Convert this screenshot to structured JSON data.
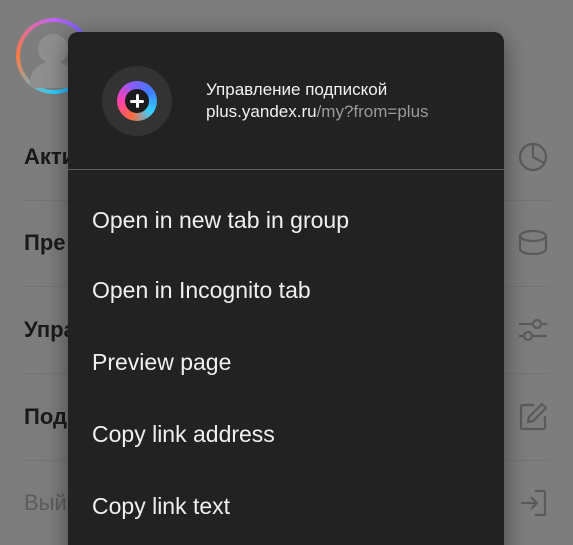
{
  "background_page": {
    "rows": [
      {
        "label": "Акти",
        "icon": "pie-chart-icon",
        "muted": false
      },
      {
        "label": "Пре",
        "icon": "database-icon",
        "muted": false
      },
      {
        "label": "Упра",
        "icon": "sliders-icon",
        "muted": false
      },
      {
        "label": "Под",
        "icon": "edit-icon",
        "muted": false
      },
      {
        "label": "Вый",
        "icon": "sign-in-icon",
        "muted": true
      }
    ]
  },
  "context_menu": {
    "header": {
      "title": "Управление подпиской",
      "url_host": "plus.yandex.ru",
      "url_path": "/my?from=plus",
      "favicon": "yandex-plus-icon"
    },
    "items": [
      {
        "label": "Open in new tab in group"
      },
      {
        "label": "Open in Incognito tab"
      },
      {
        "label": "Preview page"
      },
      {
        "label": "Copy link address"
      },
      {
        "label": "Copy link text"
      }
    ]
  },
  "colors": {
    "menu_background": "#222222",
    "scrim": "#7d7d7d",
    "menu_text": "#f0f0f0",
    "url_path_text": "#9a9a9a"
  }
}
